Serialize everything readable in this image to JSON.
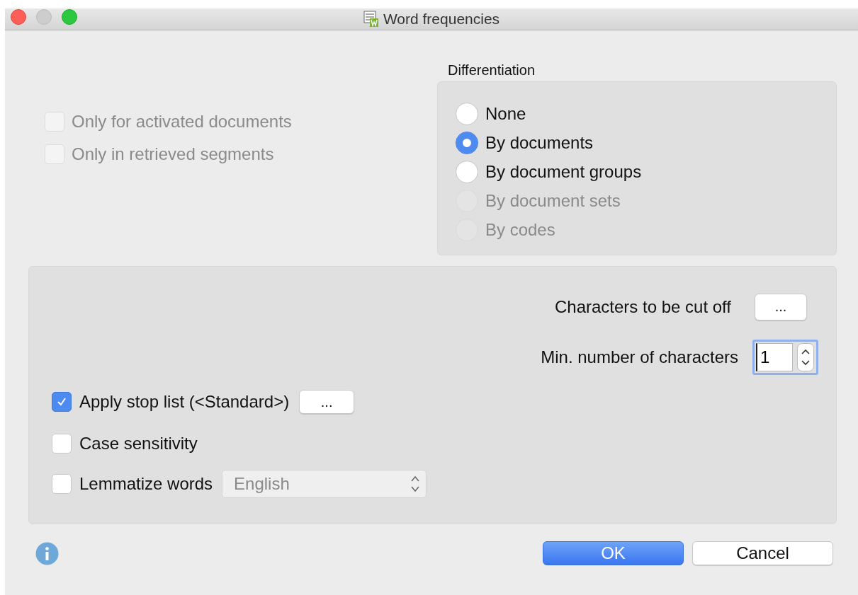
{
  "window": {
    "title": "Word frequencies"
  },
  "filters": [
    {
      "label": "Only for activated documents",
      "checked": false,
      "disabled": true
    },
    {
      "label": "Only in retrieved segments",
      "checked": false,
      "disabled": true
    }
  ],
  "differentiation": {
    "label": "Differentiation",
    "options": [
      {
        "label": "None",
        "selected": false,
        "disabled": false
      },
      {
        "label": "By documents",
        "selected": true,
        "disabled": false
      },
      {
        "label": "By document groups",
        "selected": false,
        "disabled": false
      },
      {
        "label": "By document sets",
        "selected": false,
        "disabled": true
      },
      {
        "label": "By codes",
        "selected": false,
        "disabled": true
      }
    ]
  },
  "cut_off": {
    "label": "Characters to be cut off",
    "button": "..."
  },
  "min_chars": {
    "label": "Min. number of characters",
    "value": "1"
  },
  "stop_list": {
    "label": "Apply stop list (<Standard>)",
    "checked": true,
    "button": "..."
  },
  "case_sensitivity": {
    "label": "Case sensitivity",
    "checked": false
  },
  "lemmatize": {
    "label": "Lemmatize words",
    "checked": false,
    "language": "English",
    "language_disabled": true
  },
  "buttons": [
    {
      "label": "OK",
      "kind": "default"
    },
    {
      "label": "Cancel",
      "kind": "normal"
    }
  ]
}
